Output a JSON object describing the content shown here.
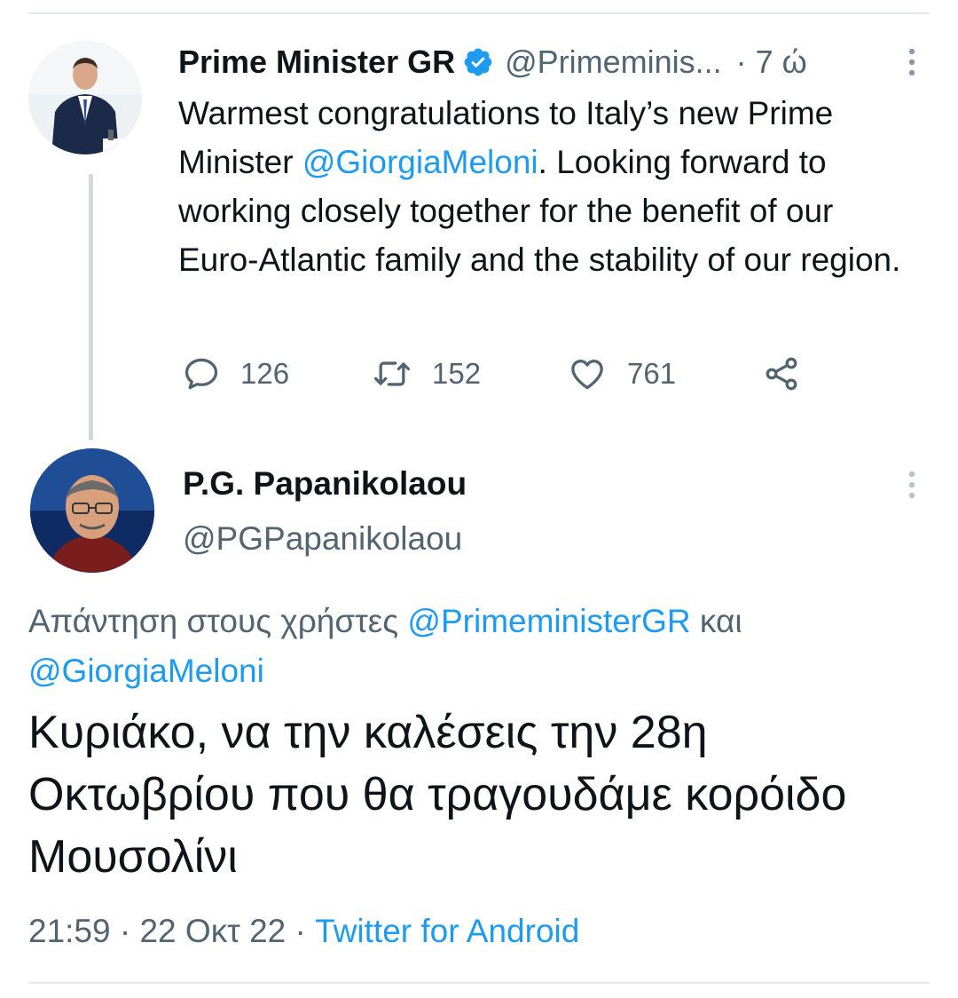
{
  "tweet1": {
    "author_name": "Prime Minister GR",
    "author_handle": "@Primeminis...",
    "time": "· 7 ώ",
    "text_before_mention": "Warmest congratulations to Italy’s new Prime Minister ",
    "mention": "@GiorgiaMeloni",
    "text_after_mention": ". Looking forward to working closely together for the benefit of our Euro-Atlantic family and the stability of our region.",
    "replies": "126",
    "retweets": "152",
    "likes": "761",
    "icons": [
      "verified-badge-icon",
      "more-options-icon",
      "reply-icon",
      "retweet-icon",
      "like-icon",
      "share-icon"
    ]
  },
  "tweet2": {
    "author_name": "P.G. Papanikolaou",
    "author_handle": "@PGPapanikolaou",
    "replying_prefix": "Απάντηση στους χρήστες ",
    "replying_to_1": "@PrimeministerGR",
    "replying_and": " και ",
    "replying_to_2": "@GiorgiaMeloni",
    "text": "Κυριάκο, να την καλέσεις την 28η Οκτωβρίου που θα τραγουδάμε κορόιδο Μουσολίνι",
    "time": "21:59",
    "date": "22 Οκτ 22",
    "separator": " · ",
    "source": "Twitter for Android"
  },
  "colors": {
    "accent": "#1d9bf0",
    "secondary_text": "#536471",
    "primary_text": "#0f1419",
    "divider": "#e6e9ec"
  }
}
